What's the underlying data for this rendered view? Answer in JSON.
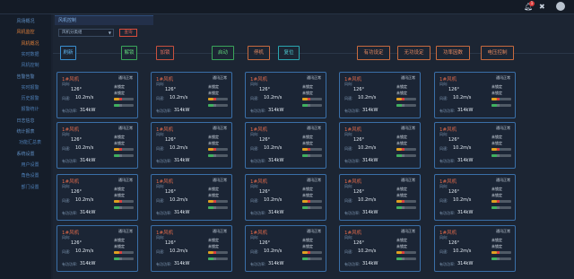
{
  "header": {
    "bell_count": "1"
  },
  "sidebar": {
    "items": [
      {
        "label": "风场概况",
        "state": "normal"
      },
      {
        "label": "风机监控",
        "state": "active"
      },
      {
        "label": "风机概况",
        "state": "sub-active"
      },
      {
        "label": "实时数据",
        "state": "sub"
      },
      {
        "label": "风机控制",
        "state": "sub"
      },
      {
        "label": "告警告警",
        "state": "normal"
      },
      {
        "label": "实时报警",
        "state": "sub"
      },
      {
        "label": "历史报警",
        "state": "sub"
      },
      {
        "label": "报警统计",
        "state": "sub"
      },
      {
        "label": "日志信息",
        "state": "normal"
      },
      {
        "label": "统计报表",
        "state": "normal"
      },
      {
        "label": "功能汇总表",
        "state": "sub"
      },
      {
        "label": "系统设置",
        "state": "normal"
      },
      {
        "label": "用户设置",
        "state": "sub"
      },
      {
        "label": "角色设置",
        "state": "sub"
      },
      {
        "label": "部门设置",
        "state": "sub"
      }
    ]
  },
  "main": {
    "breadcrumb": "风机控制",
    "filter": {
      "select_value": "风机分类组",
      "query_label": "查询"
    },
    "buttons": [
      "刷新",
      "解锁",
      "加锁",
      "启动",
      "停机",
      "复位",
      "有功设定",
      "无功设定",
      "功率因数",
      "电压控制"
    ]
  },
  "card_template": {
    "name": "1#风机",
    "status": "通讯正常",
    "wind_dir_label": "风向:",
    "wind_dir_value": "126°",
    "wind_speed_label": "风速:",
    "wind_speed_value": "10.2m/s",
    "power_label": "有功功率:",
    "power_value": "314kW",
    "lock_1": "未锁定",
    "lock_2": "未锁定"
  }
}
